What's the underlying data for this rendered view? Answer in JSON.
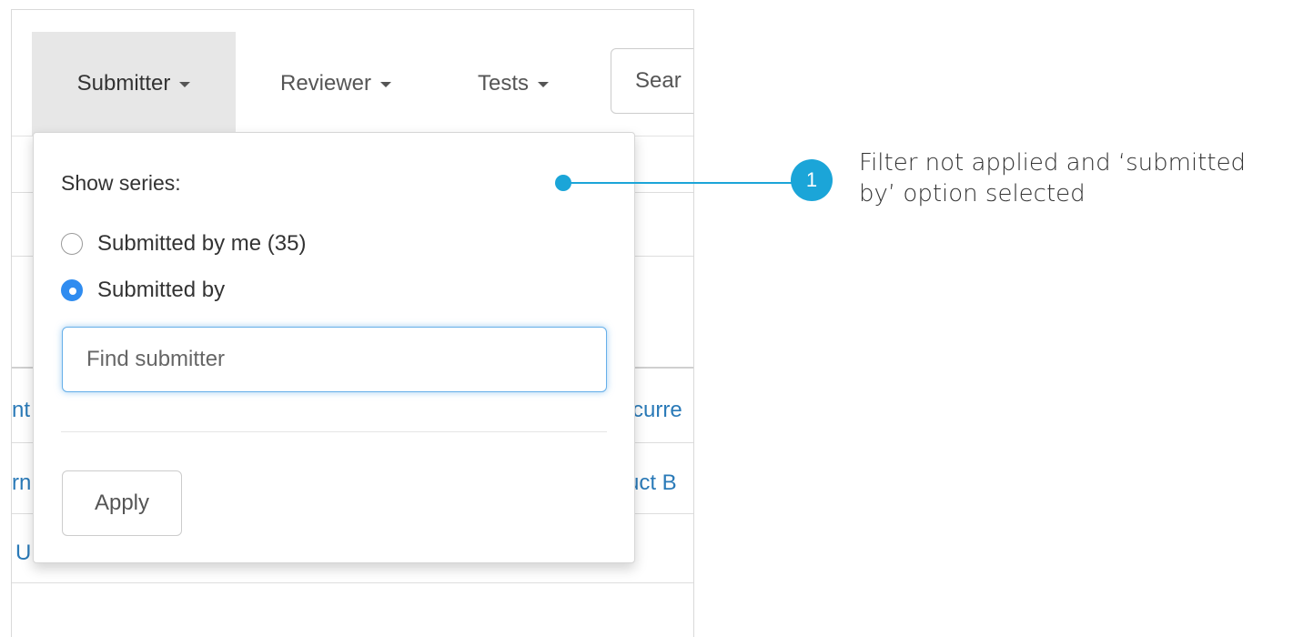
{
  "navbar": {
    "items": [
      {
        "label": "Submitter"
      },
      {
        "label": "Reviewer"
      },
      {
        "label": "Tests"
      }
    ],
    "search_placeholder": "Sear"
  },
  "table_fragments": {
    "row1_left": "nt",
    "row1_right": "curre",
    "row2_left": "rn",
    "row2_right": "uct B",
    "row3_left": "U"
  },
  "dropdown": {
    "heading": "Show series:",
    "options": [
      {
        "label": "Submitted by me (35)",
        "checked": false
      },
      {
        "label": "Submitted by",
        "checked": true
      }
    ],
    "find_placeholder": "Find submitter",
    "apply_label": "Apply"
  },
  "annotation": {
    "badge_number": "1",
    "text": "Filter not applied and ‘submitted by’ option selected",
    "color": "#1ba5d8"
  },
  "colors": {
    "accent": "#2f8cf0",
    "link": "#2a7ab8",
    "focus": "#66afe9"
  }
}
